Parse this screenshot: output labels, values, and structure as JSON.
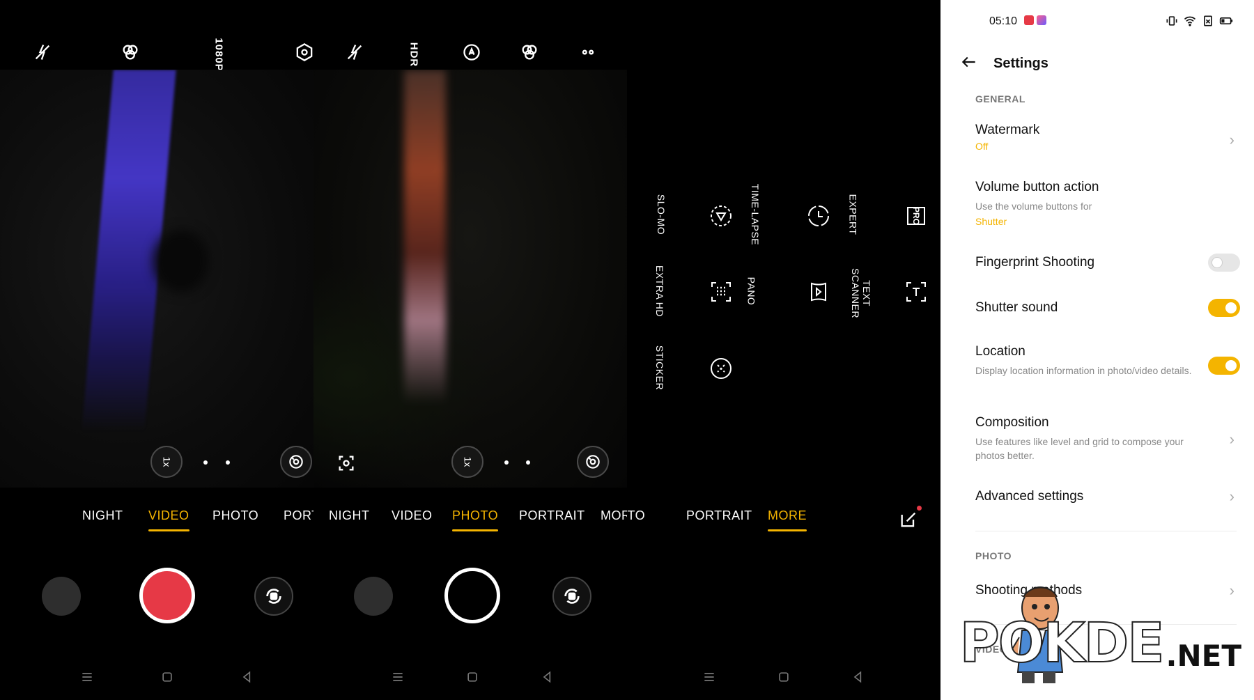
{
  "panel1": {
    "top_icons": [
      "flash-off-icon",
      "filter-icon",
      "resolution-label",
      "settings-icon"
    ],
    "resolution": "1080P",
    "zoom": "1x",
    "modes": [
      "NIGHT",
      "VIDEO",
      "PHOTO",
      "PORTRA"
    ],
    "active_mode": "VIDEO"
  },
  "panel2": {
    "hdr": "HDR",
    "zoom": "1x",
    "modes": [
      "NIGHT",
      "VIDEO",
      "PHOTO",
      "PORTRAIT",
      "MORE"
    ],
    "active_mode": "PHOTO"
  },
  "panel3": {
    "modes": [
      "PHOTO",
      "PORTRAIT",
      "MORE"
    ],
    "active_mode": "MORE",
    "more_modes": [
      {
        "label": "SLO-MO",
        "icon": "slow-motion-icon"
      },
      {
        "label": "TIME-LAPSE",
        "icon": "timelapse-icon"
      },
      {
        "label": "EXPERT",
        "icon": "pro-icon"
      },
      {
        "label": "EXTRA HD",
        "icon": "extra-hd-icon"
      },
      {
        "label": "PANO",
        "icon": "panorama-icon"
      },
      {
        "label": "TEXT\nSCANNER",
        "icon": "text-scanner-icon"
      },
      {
        "label": "STICKER",
        "icon": "sticker-icon"
      }
    ],
    "pro_badge": "PRO"
  },
  "settings": {
    "time": "05:10",
    "title": "Settings",
    "sections": {
      "general": "GENERAL",
      "photo": "PHOTO",
      "video": "VIDEO"
    },
    "watermark": {
      "title": "Watermark",
      "value": "Off"
    },
    "volume": {
      "title": "Volume button action",
      "subtitle": "Use the volume buttons for",
      "value": "Shutter"
    },
    "fingerprint": {
      "title": "Fingerprint Shooting",
      "on": false
    },
    "shutter_sound": {
      "title": "Shutter sound",
      "on": true
    },
    "location": {
      "title": "Location",
      "subtitle": "Display location information in photo/video details.",
      "on": true
    },
    "composition": {
      "title": "Composition",
      "subtitle": "Use features like level and grid to compose your photos better."
    },
    "advanced": {
      "title": "Advanced settings"
    },
    "shooting": {
      "title": "Shooting methods"
    }
  },
  "watermark_logo": {
    "word": "POKDE",
    "tld": ".NET"
  },
  "colors": {
    "accent": "#f4b400",
    "record": "#e63946"
  }
}
